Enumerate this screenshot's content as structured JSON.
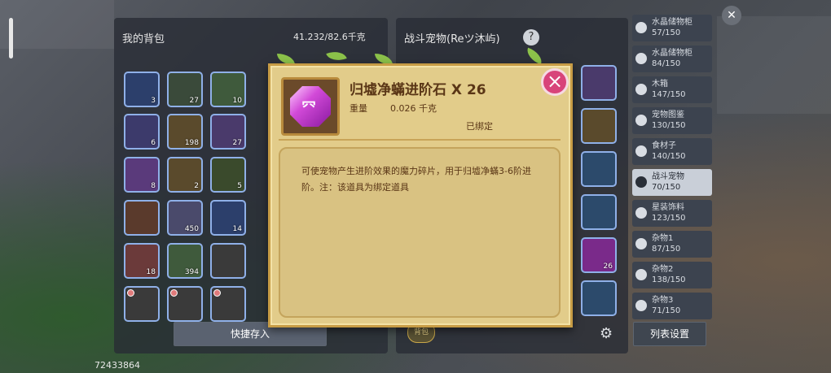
{
  "hud": {
    "player_id": "72433864"
  },
  "backpack": {
    "title": "我的背包",
    "weight": "41.232/82.6千克",
    "quick_store": "快捷存入",
    "slots": [
      {
        "count": "3",
        "color": "#2c3f6b"
      },
      {
        "count": "27",
        "color": "#3a4a3a"
      },
      {
        "count": "10",
        "color": "#3f5a3c"
      },
      {
        "count": "6",
        "color": "#3c3a6b"
      },
      {
        "count": "198",
        "color": "#5a4a2c"
      },
      {
        "count": "27",
        "color": "#4a3a6b"
      },
      {
        "count": "8",
        "color": "#5a3a7b"
      },
      {
        "count": "2",
        "color": "#5a4a2c"
      },
      {
        "count": "5",
        "color": "#3a4a2c"
      },
      {
        "count": "",
        "color": "#5a3a2c"
      },
      {
        "count": "450",
        "color": "#4a4a6b"
      },
      {
        "count": "14",
        "color": "#2c3f6b"
      },
      {
        "count": "18",
        "color": "#6b3a3a"
      },
      {
        "count": "394",
        "color": "#3f5a3c"
      },
      {
        "count": "",
        "color": "#3a3a3a"
      },
      {
        "count": "",
        "color": "#3a3a3a"
      },
      {
        "count": "",
        "color": "#3a3a3a"
      },
      {
        "count": "",
        "color": "#3a3a3a"
      }
    ]
  },
  "storage": {
    "title": "战斗宠物(Reツ沐屿)",
    "help": "?",
    "settings_label": "列表设置",
    "bottom_button": "背包",
    "right_slots": [
      {
        "count": "",
        "color": "#4a3a6b"
      },
      {
        "count": "",
        "color": "#5a4a2c"
      },
      {
        "count": "",
        "color": "#2c4a6b"
      },
      {
        "count": "",
        "color": "#2c4a6b"
      },
      {
        "count": "26",
        "color": "#7a2a8a"
      },
      {
        "count": "",
        "color": "#2c4a6b"
      }
    ]
  },
  "categories": [
    {
      "name": "水晶储物柜",
      "count": "57/150"
    },
    {
      "name": "水晶储物柜",
      "count": "84/150"
    },
    {
      "name": "木箱",
      "count": "147/150"
    },
    {
      "name": "宠物图鉴",
      "count": "130/150"
    },
    {
      "name": "食材子",
      "count": "140/150"
    },
    {
      "name": "战斗宠物",
      "count": "70/150",
      "active": true
    },
    {
      "name": "星装饰料",
      "count": "123/150"
    },
    {
      "name": "杂物1",
      "count": "87/150"
    },
    {
      "name": "杂物2",
      "count": "138/150"
    },
    {
      "name": "杂物3",
      "count": "71/150"
    }
  ],
  "popup": {
    "item_name": "归墟净蟎进阶石 X 26",
    "weight_label": "重量",
    "weight_value": "0.026 千克",
    "bind_status": "已绑定",
    "description": "可使宠物产生进阶效果的魔力碎片，用于归墟净蟎3-6阶进阶。注：该道具为绑定道具",
    "close": "×",
    "gem_symbol": "⺳"
  },
  "colors": {
    "accent": "#c79c45",
    "close": "#d8447a",
    "parchment": "#e2cc8a"
  }
}
